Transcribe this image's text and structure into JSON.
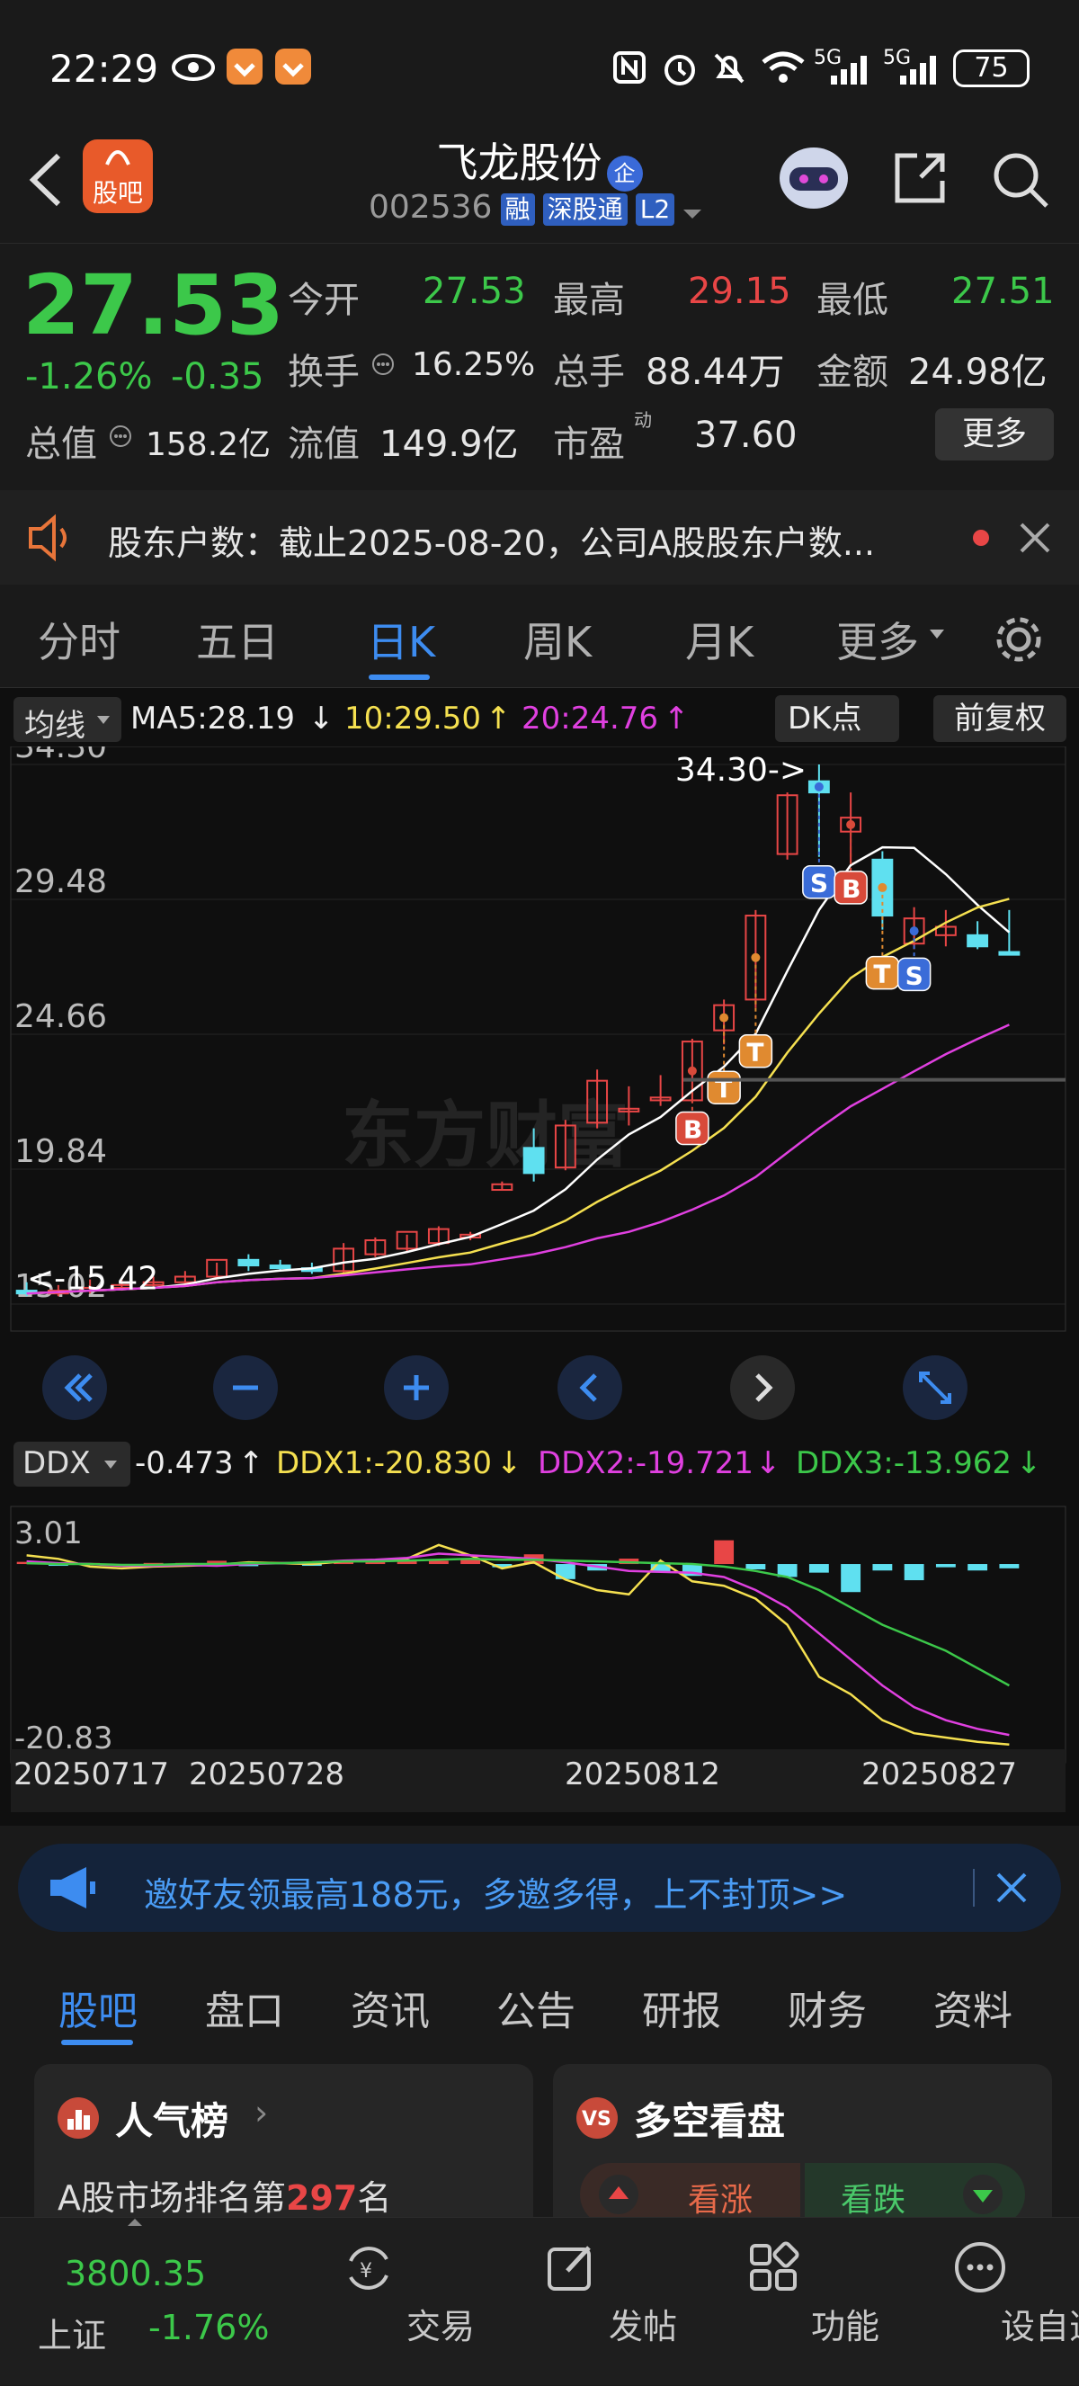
{
  "status_bar": {
    "time": "22:29",
    "signal1": "5G",
    "signal2": "5G",
    "battery": "75"
  },
  "header": {
    "logo_text": "股吧",
    "stock_name": "飞龙股份",
    "badge": "企",
    "stock_code": "002536",
    "tags": [
      "融",
      "深股通",
      "L2"
    ]
  },
  "quote": {
    "price": "27.53",
    "change_pct": "-1.26%",
    "change_abs": "-0.35",
    "open_label": "今开",
    "open": "27.53",
    "high_label": "最高",
    "high": "29.15",
    "low_label": "最低",
    "low": "27.51",
    "turnover_label": "换手",
    "turnover": "16.25%",
    "volume_label": "总手",
    "volume": "88.44万",
    "amount_label": "金额",
    "amount": "24.98亿",
    "mktcap_label": "总值",
    "mktcap": "158.2亿",
    "float_label": "流值",
    "float_cap": "149.9亿",
    "pe_label": "市盈",
    "pe_sup": "动",
    "pe": "37.60",
    "more_button": "更多"
  },
  "notice": {
    "text": "股东户数：截止2025-08-20，公司A股股东户数..."
  },
  "kline_tabs": {
    "items": [
      "分时",
      "五日",
      "日K",
      "周K",
      "月K",
      "更多"
    ],
    "active": 2
  },
  "chart_controls": {
    "ma_selector": "均线",
    "ma5": "MA5:28.19",
    "ma10": "10:29.50",
    "ma20": "20:24.76",
    "dk_button": "DK点",
    "adjust_button": "前复权",
    "ddx_selector": "DDX",
    "ddx_value": "-0.473",
    "ddx1": "DDX1:-20.830",
    "ddx2": "DDX2:-19.721",
    "ddx3": "DDX3:-13.962",
    "watermark": "东方财富"
  },
  "chart_data": {
    "type": "candlestick",
    "y_ticks": [
      "34.30",
      "29.48",
      "24.66",
      "19.84",
      "15.02"
    ],
    "ylim": [
      15.02,
      34.3
    ],
    "max_label": "34.30->",
    "min_label": "<-15.42",
    "candles": [
      {
        "o": 15.5,
        "h": 15.8,
        "l": 15.3,
        "c": 15.4
      },
      {
        "o": 15.4,
        "h": 15.7,
        "l": 15.3,
        "c": 15.5
      },
      {
        "o": 15.5,
        "h": 15.9,
        "l": 15.4,
        "c": 15.6
      },
      {
        "o": 15.6,
        "h": 15.9,
        "l": 15.5,
        "c": 15.7
      },
      {
        "o": 15.7,
        "h": 16.0,
        "l": 15.6,
        "c": 15.8
      },
      {
        "o": 15.8,
        "h": 16.2,
        "l": 15.7,
        "c": 16.0
      },
      {
        "o": 16.0,
        "h": 16.5,
        "l": 15.9,
        "c": 16.6
      },
      {
        "o": 16.6,
        "h": 16.8,
        "l": 16.2,
        "c": 16.4
      },
      {
        "o": 16.4,
        "h": 16.6,
        "l": 16.2,
        "c": 16.3
      },
      {
        "o": 16.3,
        "h": 16.5,
        "l": 16.1,
        "c": 16.2
      },
      {
        "o": 16.2,
        "h": 17.2,
        "l": 16.1,
        "c": 17.0
      },
      {
        "o": 16.8,
        "h": 17.4,
        "l": 16.7,
        "c": 17.3
      },
      {
        "o": 17.0,
        "h": 17.5,
        "l": 16.9,
        "c": 17.6
      },
      {
        "o": 17.2,
        "h": 17.8,
        "l": 17.1,
        "c": 17.7
      },
      {
        "o": 17.4,
        "h": 17.6,
        "l": 17.3,
        "c": 17.5
      },
      {
        "o": 19.1,
        "h": 19.4,
        "l": 19.1,
        "c": 19.3
      },
      {
        "o": 20.6,
        "h": 21.3,
        "l": 19.4,
        "c": 19.7
      },
      {
        "o": 19.9,
        "h": 21.6,
        "l": 19.8,
        "c": 21.4
      },
      {
        "o": 21.5,
        "h": 23.4,
        "l": 21.3,
        "c": 23.0
      },
      {
        "o": 21.9,
        "h": 22.8,
        "l": 21.4,
        "c": 22.0
      },
      {
        "o": 22.3,
        "h": 23.2,
        "l": 22.1,
        "c": 22.4
      },
      {
        "o": 22.3,
        "h": 24.5,
        "l": 22.2,
        "c": 24.4
      },
      {
        "o": 24.8,
        "h": 25.9,
        "l": 24.3,
        "c": 25.7
      },
      {
        "o": 25.9,
        "h": 29.1,
        "l": 25.6,
        "c": 28.9
      },
      {
        "o": 31.1,
        "h": 33.3,
        "l": 30.9,
        "c": 33.2
      },
      {
        "o": 33.7,
        "h": 34.3,
        "l": 31.0,
        "c": 33.3
      },
      {
        "o": 31.9,
        "h": 33.3,
        "l": 30.8,
        "c": 32.4
      },
      {
        "o": 30.9,
        "h": 31.2,
        "l": 28.4,
        "c": 28.9
      },
      {
        "o": 27.9,
        "h": 29.2,
        "l": 27.7,
        "c": 28.8
      },
      {
        "o": 28.2,
        "h": 29.1,
        "l": 27.8,
        "c": 28.5
      },
      {
        "o": 28.2,
        "h": 28.7,
        "l": 27.7,
        "c": 27.8
      },
      {
        "o": 27.6,
        "h": 29.1,
        "l": 27.5,
        "c": 27.5
      }
    ],
    "series": [
      {
        "name": "MA5",
        "color": "#ffffff"
      },
      {
        "name": "MA10",
        "color": "#f5e050"
      },
      {
        "name": "MA20",
        "color": "#e040e0"
      }
    ],
    "signals": [
      {
        "label": "B",
        "index": 21,
        "color": "#d84a3a"
      },
      {
        "label": "T",
        "index": 22,
        "color": "#e08a30"
      },
      {
        "label": "T",
        "index": 23,
        "color": "#e08a30"
      },
      {
        "label": "S",
        "index": 25,
        "color": "#3a6cd8"
      },
      {
        "label": "B",
        "index": 26,
        "color": "#d84a3a"
      },
      {
        "label": "T",
        "index": 27,
        "color": "#e08a30"
      },
      {
        "label": "S",
        "index": 28,
        "color": "#3a6cd8"
      }
    ],
    "ddx_ticks": [
      "3.01",
      "-20.83"
    ],
    "ddx_ylim": [
      -20.83,
      3.01
    ],
    "dates": [
      "20250717",
      "20250728",
      "20250812",
      "20250827"
    ]
  },
  "promo": {
    "text": "邀好友领最高188元，多邀多得，上不封顶>>"
  },
  "sub_tabs": {
    "items": [
      "股吧",
      "盘口",
      "资讯",
      "公告",
      "研报",
      "财务",
      "资料"
    ],
    "active": 0
  },
  "cards": {
    "popularity_title": "人气榜",
    "popularity_text_pre": "A股市场排名第",
    "popularity_rank": "297",
    "popularity_text_post": "名",
    "sentiment_title": "多空看盘",
    "bullish": "看涨",
    "bearish": "看跌"
  },
  "bottom_nav": {
    "index_value": "3800.35",
    "index_name": "上证",
    "index_change": "-1.76%",
    "items": [
      "交易",
      "发帖",
      "功能",
      "设自选"
    ]
  }
}
